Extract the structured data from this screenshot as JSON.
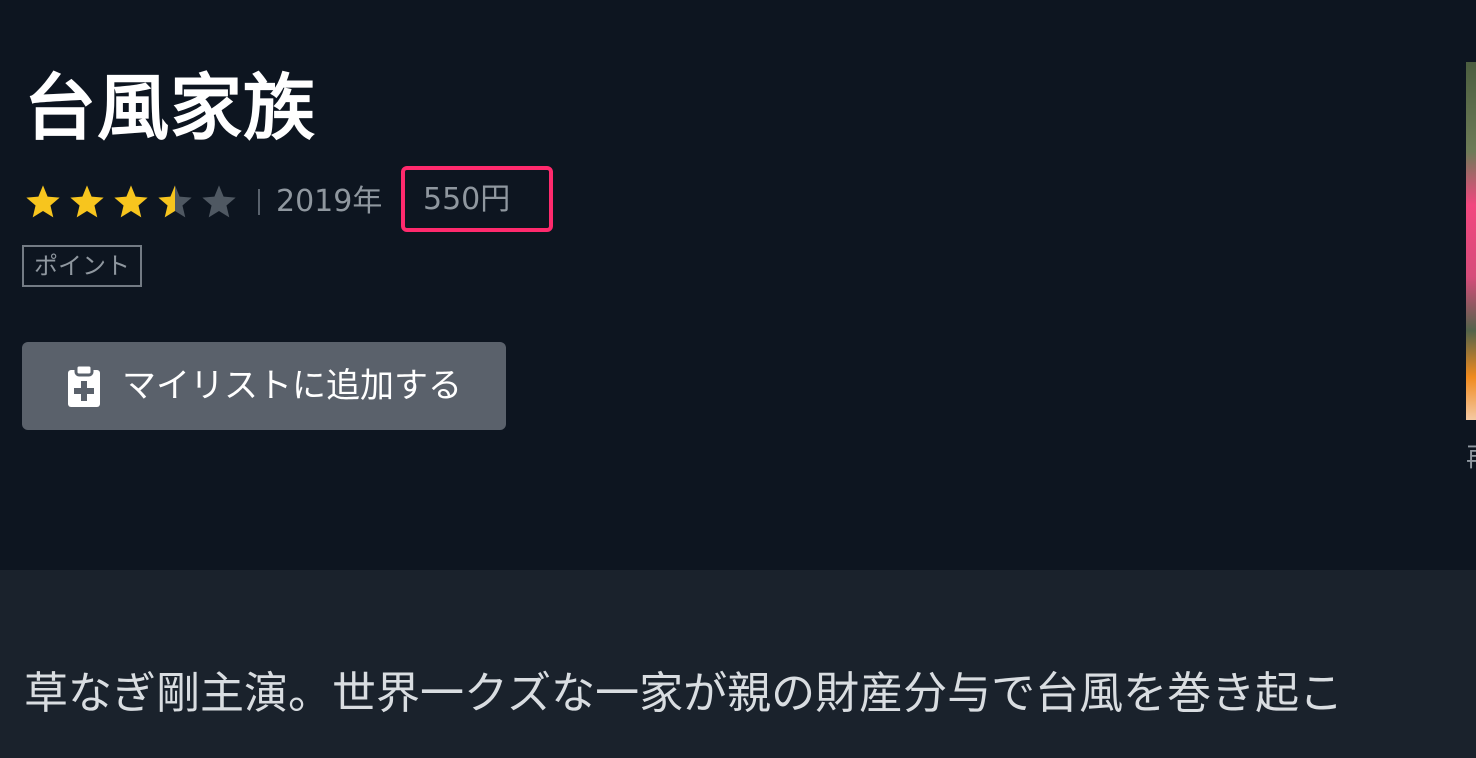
{
  "title": "台風家族",
  "rating": {
    "value": 3.5,
    "max": 5,
    "filled_color": "#f7c51e",
    "empty_color": "#4f5862"
  },
  "year": "2019年",
  "price": "550円",
  "highlight_color": "#ff2a6d",
  "tag": "ポイント",
  "mylist_button": {
    "label": "マイリストに追加する",
    "icon": "clipboard-plus-icon"
  },
  "side_glyph": "再",
  "description": "草なぎ剛主演。世界一クズな一家が親の財産分与で台風を巻き起こ"
}
